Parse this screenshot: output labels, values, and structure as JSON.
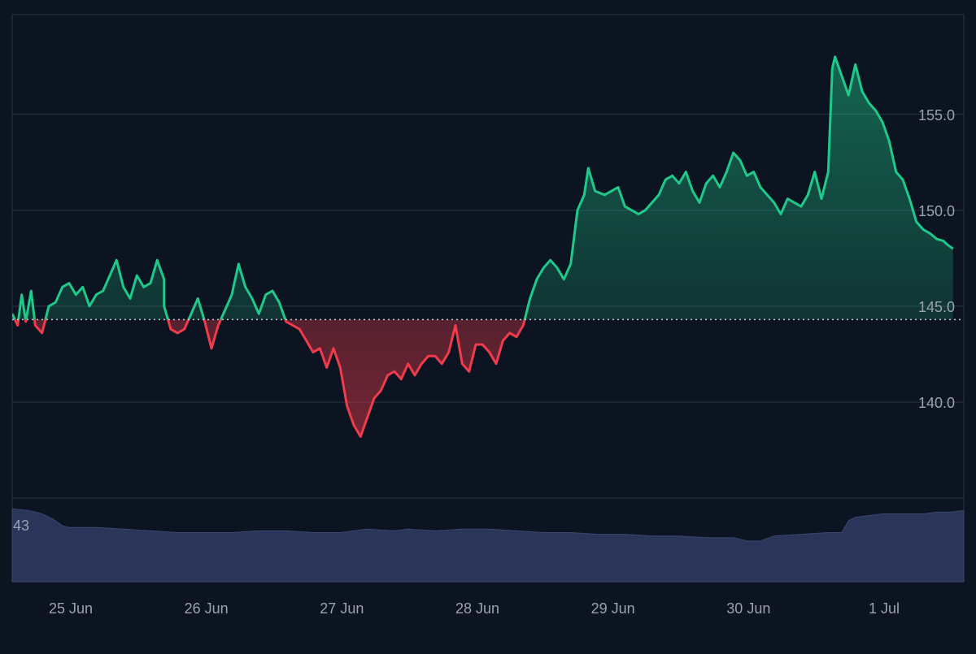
{
  "chart_data": {
    "type": "area",
    "baseline": 144.3,
    "ylim": [
      135.0,
      160.2
    ],
    "y_ticks": [
      140.0,
      145.0,
      150.0,
      155.0
    ],
    "y_tick_labels": [
      "140.0",
      "145.0",
      "150.0",
      "155.0"
    ],
    "x_tick_labels": [
      "25 Jun",
      "26 Jun",
      "27 Jun",
      "28 Jun",
      "29 Jun",
      "30 Jun",
      "1 Jul"
    ],
    "x_tick_days": [
      0,
      1,
      2,
      3,
      4,
      5,
      6
    ],
    "x_range_days": [
      -0.42,
      6.6
    ],
    "series": [
      {
        "points": [
          [
            -0.42,
            144.6
          ],
          [
            -0.38,
            144.0
          ],
          [
            -0.35,
            145.6
          ],
          [
            -0.32,
            144.2
          ],
          [
            -0.28,
            145.8
          ],
          [
            -0.25,
            144.0
          ],
          [
            -0.2,
            143.6
          ],
          [
            -0.15,
            145.0
          ],
          [
            -0.1,
            145.2
          ],
          [
            -0.05,
            146.0
          ],
          [
            0.0,
            146.2
          ],
          [
            0.05,
            145.6
          ],
          [
            0.1,
            146.0
          ],
          [
            0.15,
            145.0
          ],
          [
            0.2,
            145.6
          ],
          [
            0.25,
            145.8
          ],
          [
            0.35,
            147.4
          ],
          [
            0.4,
            146.0
          ],
          [
            0.45,
            145.4
          ],
          [
            0.5,
            146.6
          ],
          [
            0.55,
            146.0
          ],
          [
            0.6,
            146.2
          ],
          [
            0.65,
            147.4
          ],
          [
            0.7,
            146.4
          ],
          [
            0.7,
            145.0
          ],
          [
            0.75,
            143.8
          ],
          [
            0.8,
            143.6
          ],
          [
            0.85,
            143.8
          ],
          [
            0.9,
            144.6
          ],
          [
            0.95,
            145.4
          ],
          [
            1.0,
            144.2
          ],
          [
            1.05,
            142.8
          ],
          [
            1.1,
            144.0
          ],
          [
            1.15,
            144.8
          ],
          [
            1.2,
            145.6
          ],
          [
            1.25,
            147.2
          ],
          [
            1.3,
            146.0
          ],
          [
            1.35,
            145.4
          ],
          [
            1.4,
            144.6
          ],
          [
            1.45,
            145.6
          ],
          [
            1.5,
            145.8
          ],
          [
            1.55,
            145.2
          ],
          [
            1.6,
            144.2
          ],
          [
            1.65,
            144.0
          ],
          [
            1.7,
            143.8
          ],
          [
            1.75,
            143.2
          ],
          [
            1.8,
            142.6
          ],
          [
            1.85,
            142.8
          ],
          [
            1.9,
            141.8
          ],
          [
            1.95,
            142.8
          ],
          [
            2.0,
            141.8
          ],
          [
            2.05,
            139.8
          ],
          [
            2.1,
            138.8
          ],
          [
            2.15,
            138.2
          ],
          [
            2.2,
            139.2
          ],
          [
            2.25,
            140.2
          ],
          [
            2.3,
            140.6
          ],
          [
            2.35,
            141.4
          ],
          [
            2.4,
            141.6
          ],
          [
            2.45,
            141.2
          ],
          [
            2.5,
            142.0
          ],
          [
            2.55,
            141.4
          ],
          [
            2.6,
            142.0
          ],
          [
            2.65,
            142.4
          ],
          [
            2.7,
            142.4
          ],
          [
            2.75,
            142.0
          ],
          [
            2.8,
            142.6
          ],
          [
            2.85,
            144.0
          ],
          [
            2.9,
            142.0
          ],
          [
            2.95,
            141.6
          ],
          [
            3.0,
            143.0
          ],
          [
            3.05,
            143.0
          ],
          [
            3.1,
            142.6
          ],
          [
            3.15,
            142.0
          ],
          [
            3.2,
            143.2
          ],
          [
            3.25,
            143.6
          ],
          [
            3.3,
            143.4
          ],
          [
            3.35,
            144.0
          ],
          [
            3.4,
            145.4
          ],
          [
            3.45,
            146.4
          ],
          [
            3.5,
            147.0
          ],
          [
            3.55,
            147.4
          ],
          [
            3.6,
            147.0
          ],
          [
            3.65,
            146.4
          ],
          [
            3.7,
            147.2
          ],
          [
            3.75,
            150.0
          ],
          [
            3.8,
            150.8
          ],
          [
            3.83,
            152.2
          ],
          [
            3.88,
            151.0
          ],
          [
            3.95,
            150.8
          ],
          [
            4.0,
            151.0
          ],
          [
            4.05,
            151.2
          ],
          [
            4.1,
            150.2
          ],
          [
            4.15,
            150.0
          ],
          [
            4.2,
            149.8
          ],
          [
            4.25,
            150.0
          ],
          [
            4.3,
            150.4
          ],
          [
            4.35,
            150.8
          ],
          [
            4.4,
            151.6
          ],
          [
            4.45,
            151.8
          ],
          [
            4.5,
            151.4
          ],
          [
            4.55,
            152.0
          ],
          [
            4.6,
            151.0
          ],
          [
            4.65,
            150.4
          ],
          [
            4.7,
            151.4
          ],
          [
            4.75,
            151.8
          ],
          [
            4.8,
            151.2
          ],
          [
            4.85,
            152.0
          ],
          [
            4.9,
            153.0
          ],
          [
            4.95,
            152.6
          ],
          [
            5.0,
            151.8
          ],
          [
            5.05,
            152.0
          ],
          [
            5.1,
            151.2
          ],
          [
            5.15,
            150.8
          ],
          [
            5.2,
            150.4
          ],
          [
            5.25,
            149.8
          ],
          [
            5.3,
            150.6
          ],
          [
            5.35,
            150.4
          ],
          [
            5.4,
            150.2
          ],
          [
            5.45,
            150.8
          ],
          [
            5.5,
            152.0
          ],
          [
            5.55,
            150.6
          ],
          [
            5.6,
            152.0
          ],
          [
            5.63,
            157.4
          ],
          [
            5.65,
            158.0
          ],
          [
            5.7,
            157.0
          ],
          [
            5.75,
            156.0
          ],
          [
            5.8,
            157.6
          ],
          [
            5.85,
            156.2
          ],
          [
            5.9,
            155.6
          ],
          [
            5.95,
            155.2
          ],
          [
            6.0,
            154.6
          ],
          [
            6.05,
            153.6
          ],
          [
            6.1,
            152.0
          ],
          [
            6.15,
            151.6
          ],
          [
            6.2,
            150.6
          ],
          [
            6.25,
            149.4
          ],
          [
            6.3,
            149.0
          ],
          [
            6.35,
            148.8
          ],
          [
            6.4,
            148.5
          ],
          [
            6.45,
            148.4
          ],
          [
            6.48,
            148.2
          ],
          [
            6.52,
            148.0
          ]
        ]
      }
    ],
    "volume": {
      "label": "43",
      "points": [
        [
          -0.42,
          43
        ],
        [
          -0.3,
          42
        ],
        [
          -0.2,
          40
        ],
        [
          -0.12,
          37
        ],
        [
          -0.05,
          33
        ],
        [
          0.0,
          32
        ],
        [
          0.2,
          32
        ],
        [
          0.4,
          31
        ],
        [
          0.6,
          30
        ],
        [
          0.8,
          29
        ],
        [
          1.0,
          29
        ],
        [
          1.2,
          29
        ],
        [
          1.4,
          30
        ],
        [
          1.6,
          30
        ],
        [
          1.8,
          29
        ],
        [
          2.0,
          29
        ],
        [
          2.1,
          30
        ],
        [
          2.2,
          31
        ],
        [
          2.4,
          30
        ],
        [
          2.5,
          31
        ],
        [
          2.7,
          30
        ],
        [
          2.9,
          31
        ],
        [
          3.1,
          31
        ],
        [
          3.3,
          30
        ],
        [
          3.5,
          29
        ],
        [
          3.7,
          29
        ],
        [
          3.9,
          28
        ],
        [
          4.1,
          28
        ],
        [
          4.3,
          27
        ],
        [
          4.5,
          27
        ],
        [
          4.7,
          26
        ],
        [
          4.9,
          26
        ],
        [
          5.0,
          24
        ],
        [
          5.1,
          24
        ],
        [
          5.2,
          27
        ],
        [
          5.4,
          28
        ],
        [
          5.6,
          29
        ],
        [
          5.7,
          29
        ],
        [
          5.75,
          36
        ],
        [
          5.8,
          38
        ],
        [
          5.9,
          39
        ],
        [
          6.0,
          40
        ],
        [
          6.1,
          40
        ],
        [
          6.2,
          40
        ],
        [
          6.3,
          40
        ],
        [
          6.4,
          41
        ],
        [
          6.5,
          41
        ],
        [
          6.6,
          42
        ]
      ]
    },
    "colors": {
      "background": "#0d1421",
      "up_line": "#1ec98a",
      "down_line": "#ef3b4c",
      "up_fill": "#1ec98a",
      "down_fill": "#ef3b4c",
      "grid": "#2b3446",
      "baseline": "#c8ccd4",
      "axis_text": "#9aa2b1",
      "volume": "#2a3559"
    }
  }
}
